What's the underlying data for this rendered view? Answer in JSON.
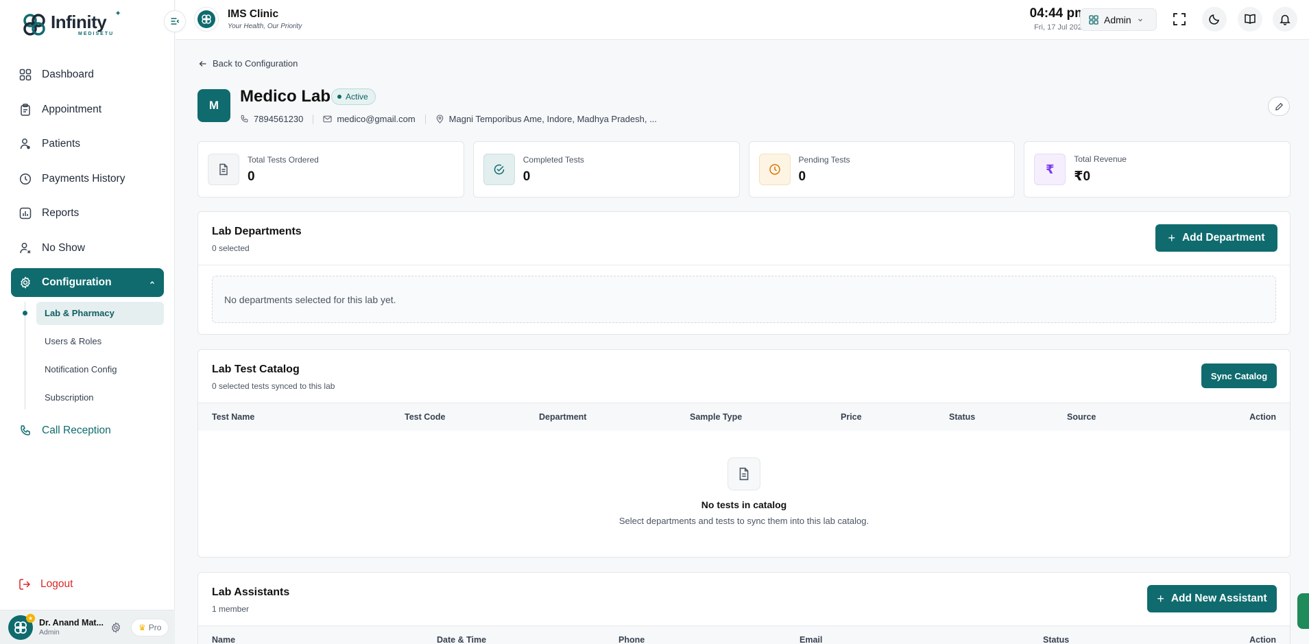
{
  "sidebar": {
    "logo": {
      "name": "Infinity",
      "sub": "MEDISETU"
    },
    "items": [
      {
        "label": "Dashboard",
        "icon": "dashboard-icon"
      },
      {
        "label": "Appointment",
        "icon": "clipboard-icon"
      },
      {
        "label": "Patients",
        "icon": "patients-icon"
      },
      {
        "label": "Payments History",
        "icon": "history-icon"
      },
      {
        "label": "Reports",
        "icon": "reports-icon"
      },
      {
        "label": "No Show",
        "icon": "user-x-icon"
      },
      {
        "label": "Configuration",
        "icon": "gear-icon"
      }
    ],
    "sub_items": [
      {
        "label": "Lab & Pharmacy"
      },
      {
        "label": "Users & Roles"
      },
      {
        "label": "Notification Config"
      },
      {
        "label": "Subscription"
      }
    ],
    "call_reception": "Call Reception",
    "logout": "Logout",
    "user": {
      "name": "Dr. Anand Mat...",
      "role": "Admin",
      "plan": "Pro"
    }
  },
  "header": {
    "clinic_name": "IMS Clinic",
    "tagline": "Your Health, Our Priority",
    "time": "04:44 pm",
    "date": "Fri, 17 Jul 2026",
    "role_select": "Admin"
  },
  "main": {
    "back_label": "Back to Configuration",
    "avatar_letter": "M",
    "lab_name": "Medico Lab",
    "status": "Active",
    "phone": "7894561230",
    "email": "medico@gmail.com",
    "address": "Magni Temporibus Ame, Indore, Madhya Pradesh, ...",
    "stats": [
      {
        "label": "Total Tests Ordered",
        "value": "0"
      },
      {
        "label": "Completed Tests",
        "value": "0"
      },
      {
        "label": "Pending Tests",
        "value": "0"
      },
      {
        "label": "Total Revenue",
        "value": "₹0"
      }
    ],
    "departments": {
      "title": "Lab Departments",
      "subtitle": "0 selected",
      "button": "Add Department",
      "empty": "No departments selected for this lab yet."
    },
    "catalog": {
      "title": "Lab Test Catalog",
      "subtitle": "0 selected tests synced to this lab",
      "button": "Sync Catalog",
      "columns": [
        "Test Name",
        "Test Code",
        "Department",
        "Sample Type",
        "Price",
        "Status",
        "Source",
        "Action"
      ],
      "empty_title": "No tests in catalog",
      "empty_sub": "Select departments and tests to sync them into this lab catalog."
    },
    "assistants": {
      "title": "Lab Assistants",
      "subtitle": "1 member",
      "button": "Add New Assistant",
      "columns": [
        "Name",
        "Date & Time",
        "Phone",
        "Email",
        "Status",
        "Action"
      ]
    }
  },
  "colors": {
    "primary": "#0f6b6e",
    "danger": "#dc2626",
    "pending": "#d97706",
    "revenue": "#7c3aed"
  }
}
